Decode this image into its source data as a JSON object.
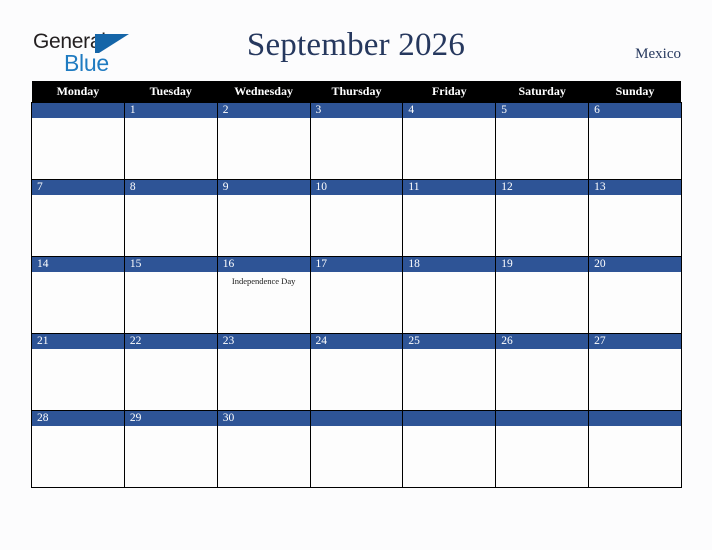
{
  "brand": {
    "name_part1": "General",
    "name_part2": "Blue",
    "triangle_icon": "brand-triangle-icon",
    "color_dark": "#231f20",
    "color_blue": "#1f7bc1"
  },
  "header": {
    "title": "September 2026",
    "country": "Mexico",
    "title_color": "#26385e"
  },
  "calendar": {
    "weekday_headers": [
      "Monday",
      "Tuesday",
      "Wednesday",
      "Thursday",
      "Friday",
      "Saturday",
      "Sunday"
    ],
    "header_bg": "#000000",
    "header_text_color": "#ffffff",
    "day_bar_color": "#2e5496",
    "day_number_color": "#ffffff",
    "cell_bg": "#fdfdfd",
    "grid_line_color": "#000000",
    "weeks": [
      [
        {
          "day": "",
          "event": ""
        },
        {
          "day": "1",
          "event": ""
        },
        {
          "day": "2",
          "event": ""
        },
        {
          "day": "3",
          "event": ""
        },
        {
          "day": "4",
          "event": ""
        },
        {
          "day": "5",
          "event": ""
        },
        {
          "day": "6",
          "event": ""
        }
      ],
      [
        {
          "day": "7",
          "event": ""
        },
        {
          "day": "8",
          "event": ""
        },
        {
          "day": "9",
          "event": ""
        },
        {
          "day": "10",
          "event": ""
        },
        {
          "day": "11",
          "event": ""
        },
        {
          "day": "12",
          "event": ""
        },
        {
          "day": "13",
          "event": ""
        }
      ],
      [
        {
          "day": "14",
          "event": ""
        },
        {
          "day": "15",
          "event": ""
        },
        {
          "day": "16",
          "event": "Independence Day"
        },
        {
          "day": "17",
          "event": ""
        },
        {
          "day": "18",
          "event": ""
        },
        {
          "day": "19",
          "event": ""
        },
        {
          "day": "20",
          "event": ""
        }
      ],
      [
        {
          "day": "21",
          "event": ""
        },
        {
          "day": "22",
          "event": ""
        },
        {
          "day": "23",
          "event": ""
        },
        {
          "day": "24",
          "event": ""
        },
        {
          "day": "25",
          "event": ""
        },
        {
          "day": "26",
          "event": ""
        },
        {
          "day": "27",
          "event": ""
        }
      ],
      [
        {
          "day": "28",
          "event": ""
        },
        {
          "day": "29",
          "event": ""
        },
        {
          "day": "30",
          "event": ""
        },
        {
          "day": "",
          "event": ""
        },
        {
          "day": "",
          "event": ""
        },
        {
          "day": "",
          "event": ""
        },
        {
          "day": "",
          "event": ""
        }
      ]
    ]
  }
}
